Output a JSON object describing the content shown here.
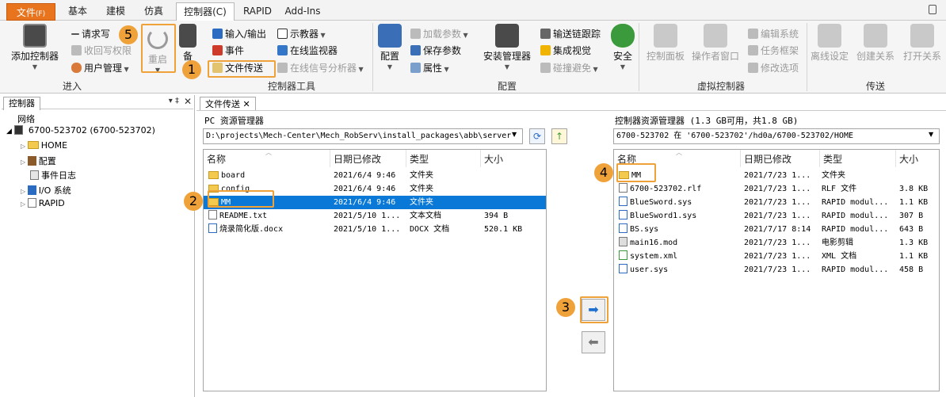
{
  "menu": {
    "file": "文件",
    "file_key": "(F)",
    "tabs": [
      "基本",
      "建模",
      "仿真",
      "控制器(C)",
      "RAPID",
      "Add-Ins"
    ]
  },
  "ribbon": {
    "groups": {
      "enter": "进入",
      "tools": "控制器工具",
      "config": "配置",
      "virtual": "虚拟控制器",
      "transfer": "传送"
    },
    "add_controller": "添加控制器",
    "request_write": "请求写",
    "revoke_write": "收回写权限",
    "user_mgmt": "用户管理",
    "restart": "重启",
    "backup_partial": "备",
    "io": "输入/输出",
    "events": "事件",
    "file_transfer": "文件传送",
    "teach_pendant": "示教器",
    "online_monitor": "在线监视器",
    "signal_analyzer": "在线信号分析器",
    "load_params": "加载参数",
    "save_params": "保存参数",
    "properties": "属性",
    "config_btn": "配置",
    "install_mgr": "安装管理器",
    "conveyor_tracking": "输送链跟踪",
    "integrated_vision": "集成视觉",
    "collision_avoid": "碰撞避免",
    "safety": "安全",
    "control_panel": "控制面板",
    "operator_window": "操作者窗口",
    "edit_system": "编辑系统",
    "task_frame": "任务框架",
    "modify_options": "修改选项",
    "offline_setup": "离线设定",
    "create_relation": "创建关系",
    "open_relation": "打开关系"
  },
  "left_panel": {
    "tab": "控制器",
    "network": "网络",
    "controller": "6700-523702 (6700-523702)",
    "items": [
      "HOME",
      "配置",
      "事件日志",
      "I/O 系统",
      "RAPID"
    ]
  },
  "doc_tab": "文件传送",
  "pc": {
    "title": "PC 资源管理器",
    "path": "D:\\projects\\Mech-Center\\Mech_RobServ\\install_packages\\abb\\server",
    "columns": [
      "名称",
      "日期已修改",
      "类型",
      "大小"
    ],
    "rows": [
      {
        "name": "board",
        "date": "2021/6/4 9:46",
        "type": "文件夹",
        "size": ""
      },
      {
        "name": "config",
        "date": "2021/6/4 9:46",
        "type": "文件夹",
        "size": ""
      },
      {
        "name": "MM",
        "date": "2021/6/4 9:46",
        "type": "文件夹",
        "size": ""
      },
      {
        "name": "README.txt",
        "date": "2021/5/10 1...",
        "type": "文本文档",
        "size": "394 B"
      },
      {
        "name": "烧录简化版.docx",
        "date": "2021/5/10 1...",
        "type": "DOCX 文档",
        "size": "520.1 KB"
      }
    ]
  },
  "ctrl": {
    "title": "控制器资源管理器 (1.3 GB可用，共1.8 GB)",
    "path": "6700-523702 在 '6700-523702'/hd0a/6700-523702/HOME",
    "columns": [
      "名称",
      "日期已修改",
      "类型",
      "大小"
    ],
    "rows": [
      {
        "name": "MM",
        "date": "2021/7/23 1...",
        "type": "文件夹",
        "size": ""
      },
      {
        "name": "6700-523702.rlf",
        "date": "2021/7/23 1...",
        "type": "RLF 文件",
        "size": "3.8 KB"
      },
      {
        "name": "BlueSword.sys",
        "date": "2021/7/23 1...",
        "type": "RAPID modul...",
        "size": "1.1 KB"
      },
      {
        "name": "BlueSword1.sys",
        "date": "2021/7/23 1...",
        "type": "RAPID modul...",
        "size": "307 B"
      },
      {
        "name": "BS.sys",
        "date": "2021/7/17 8:14",
        "type": "RAPID modul...",
        "size": "643 B"
      },
      {
        "name": "main16.mod",
        "date": "2021/7/23 1...",
        "type": "电影剪辑",
        "size": "1.3 KB"
      },
      {
        "name": "system.xml",
        "date": "2021/7/23 1...",
        "type": "XML 文档",
        "size": "1.1 KB"
      },
      {
        "name": "user.sys",
        "date": "2021/7/23 1...",
        "type": "RAPID modul...",
        "size": "458 B"
      }
    ]
  },
  "steps": [
    "1",
    "2",
    "3",
    "4",
    "5"
  ],
  "colors": {
    "file_tab": "#e8741e",
    "highlight": "#f0a23a",
    "selection": "#0a78d7"
  }
}
